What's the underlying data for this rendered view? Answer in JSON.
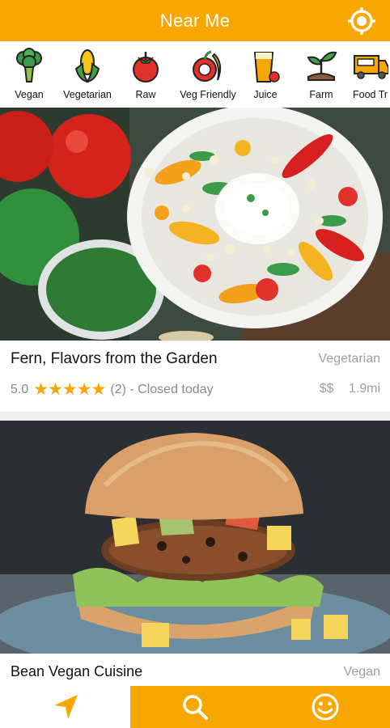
{
  "header": {
    "title": "Near Me",
    "locate_icon": "crosshair-location-icon"
  },
  "categories": [
    {
      "label": "Vegan",
      "icon": "broccoli-icon"
    },
    {
      "label": "Vegetarian",
      "icon": "corn-icon"
    },
    {
      "label": "Raw",
      "icon": "tomato-icon"
    },
    {
      "label": "Veg Friendly",
      "icon": "apple-banana-icon"
    },
    {
      "label": "Juice",
      "icon": "juice-glass-icon"
    },
    {
      "label": "Farm",
      "icon": "sprout-icon"
    },
    {
      "label": "Food Tr",
      "icon": "food-truck-icon"
    }
  ],
  "restaurants": [
    {
      "name": "Fern, Flavors from the Garden",
      "cuisine": "Vegetarian",
      "rating": "5.0",
      "stars": "★★★★★",
      "reviews": "(2) - Closed today",
      "price": "$$",
      "distance": "1.9mi"
    },
    {
      "name": "Bean Vegan Cuisine",
      "cuisine": "Vegan"
    }
  ],
  "bottom_nav": {
    "nearby_icon": "navigation-arrow-icon",
    "search_icon": "search-icon",
    "profile_icon": "smiley-icon"
  },
  "colors": {
    "accent": "#F7A700",
    "muted_text": "#9e9e9e"
  }
}
